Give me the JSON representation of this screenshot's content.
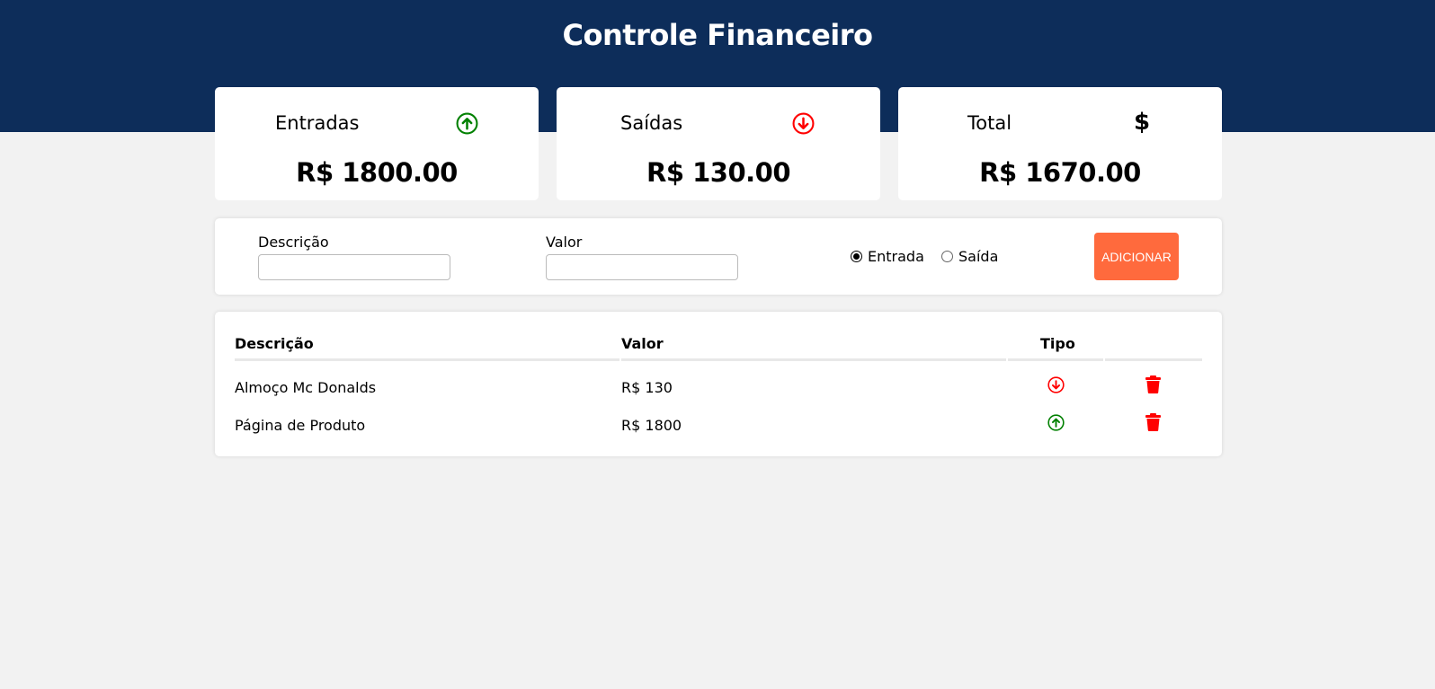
{
  "header": {
    "title": "Controle Financeiro",
    "background": "#0d2d5a"
  },
  "summary": {
    "income": {
      "label": "Entradas",
      "icon": "arrow-up-circle-icon",
      "value": "R$ 1800.00",
      "color": "#008000"
    },
    "expense": {
      "label": "Saídas",
      "icon": "arrow-down-circle-icon",
      "value": "R$ 130.00",
      "color": "#ff0000"
    },
    "total": {
      "label": "Total",
      "icon": "dollar-icon",
      "value": "R$ 1670.00"
    }
  },
  "form": {
    "description_label": "Descrição",
    "description_value": "",
    "amount_label": "Valor",
    "amount_value": "",
    "radio_income_label": "Entrada",
    "radio_expense_label": "Saída",
    "selected": "Entrada",
    "add_label": "ADICIONAR",
    "accent": "#ff6a3d"
  },
  "table": {
    "headers": {
      "description": "Descrição",
      "amount": "Valor",
      "type": "Tipo",
      "actions": ""
    },
    "rows": [
      {
        "description": "Almoço Mc Donalds",
        "amount": "R$ 130",
        "type": "saida",
        "type_icon": "arrow-down-circle-icon",
        "action_icon": "trash-icon"
      },
      {
        "description": "Página de Produto",
        "amount": "R$ 1800",
        "type": "entrada",
        "type_icon": "arrow-up-circle-icon",
        "action_icon": "trash-icon"
      }
    ]
  }
}
